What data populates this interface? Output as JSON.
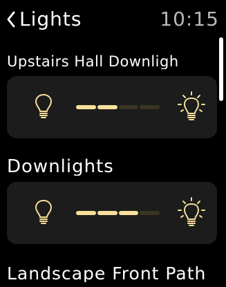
{
  "header": {
    "back_label": "Lights",
    "time": "10:15"
  },
  "colors": {
    "accent": "#f7e09a",
    "segment_off": "#3a3422",
    "card_bg": "#1c1c1c",
    "background": "#000000"
  },
  "accessories": [
    {
      "name": "Upstairs Hall Downligh",
      "brightness_fraction": 0.5,
      "segments_total": 4,
      "segments_on": 2,
      "dim_icon": "bulb-off-icon",
      "bright_icon": "bulb-on-icon"
    },
    {
      "name": "Downlights",
      "brightness_fraction": 0.75,
      "segments_total": 4,
      "segments_on": 3,
      "dim_icon": "bulb-off-icon",
      "bright_icon": "bulb-on-icon"
    },
    {
      "name": "Landscape Front Path"
    }
  ]
}
